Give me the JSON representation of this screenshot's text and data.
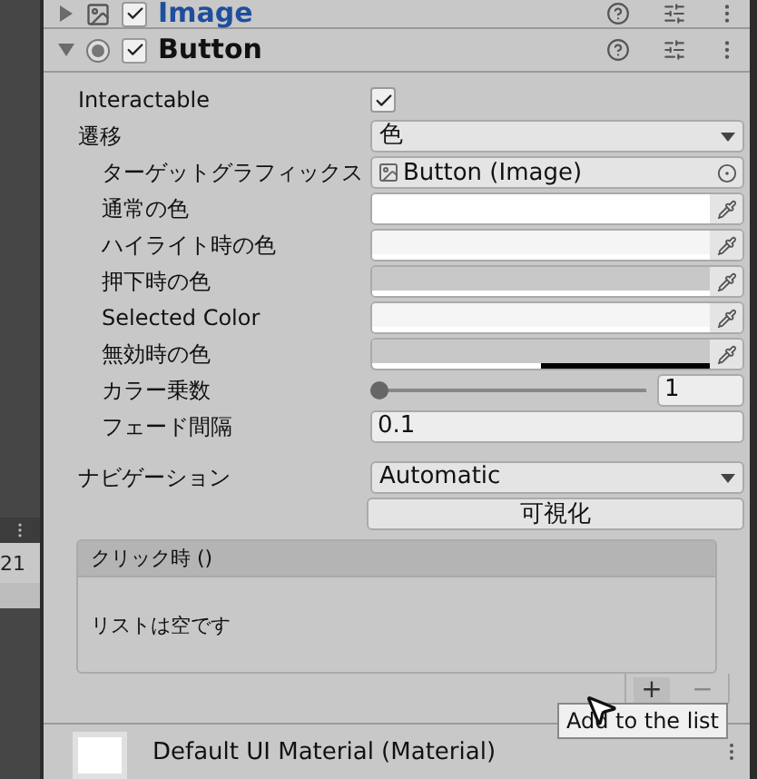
{
  "side_panel": {
    "count": "21"
  },
  "components": [
    {
      "name": "Image",
      "kind": "image",
      "expanded": false,
      "enabled": true
    },
    {
      "name": "Button",
      "kind": "button",
      "expanded": true,
      "enabled": true
    }
  ],
  "properties": [
    {
      "kind": "checkbox",
      "label": "Interactable",
      "checked": true
    },
    {
      "kind": "dropdown",
      "label": "遷移",
      "value": "色",
      "children": [
        {
          "kind": "object",
          "label": "ターゲットグラフィックス",
          "value": "Button (Image)"
        },
        {
          "kind": "color",
          "label": "通常の色",
          "color": "#ffffff",
          "level": 1
        },
        {
          "kind": "color",
          "label": "ハイライト時の色",
          "color": "#f5f5f5",
          "level": 1
        },
        {
          "kind": "color",
          "label": "押下時の色",
          "color": "#c8c8c8",
          "level": 1
        },
        {
          "kind": "color",
          "label": "Selected Color",
          "color": "#f5f5f5",
          "level": 1
        },
        {
          "kind": "color",
          "label": "無効時の色",
          "color": "#c8c8c8",
          "level": 0.5
        },
        {
          "kind": "slider",
          "label": "カラー乗数",
          "level": 0,
          "value": "1"
        },
        {
          "kind": "number",
          "label": "フェード間隔",
          "value": "0.1"
        }
      ]
    },
    {
      "kind": "dropdown",
      "label": "ナビゲーション",
      "value": "Automatic"
    },
    {
      "kind": "button",
      "value": "可視化"
    }
  ],
  "event": {
    "title": "クリック時 ()",
    "empty_text": "リストは空です",
    "add": "+",
    "remove": "−",
    "tooltip": "Add to the list"
  },
  "material": {
    "name": "Default UI Material (Material)"
  }
}
